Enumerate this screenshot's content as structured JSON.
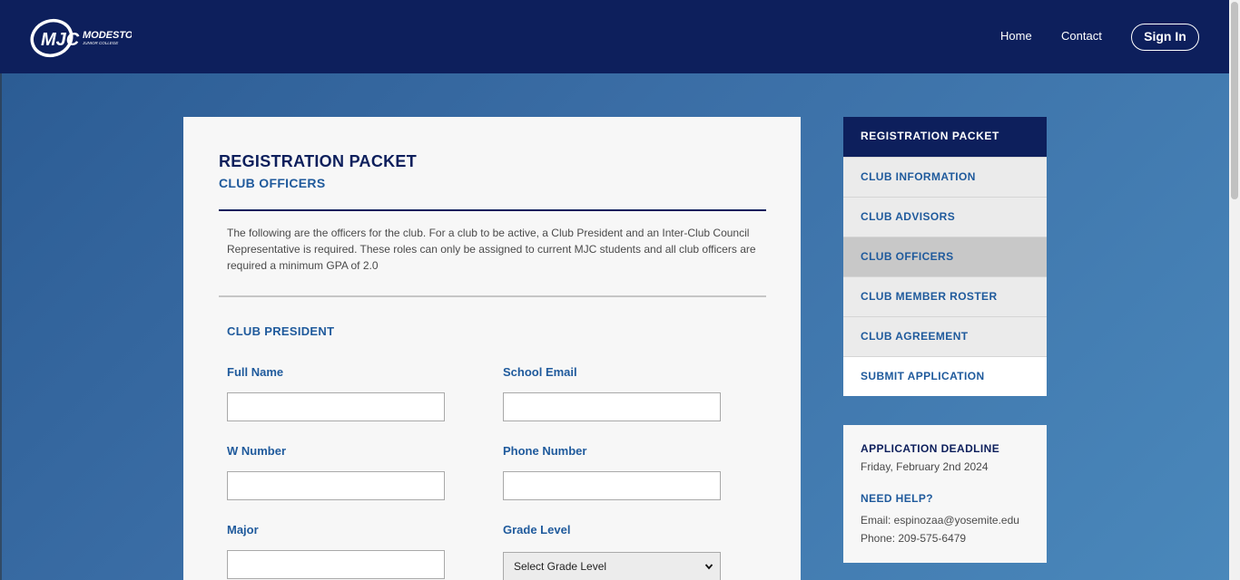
{
  "header": {
    "logo_text": "MJC MODESTO JUNIOR COLLEGE",
    "nav": [
      "Home",
      "Contact"
    ],
    "signin_label": "Sign In"
  },
  "main": {
    "title": "REGISTRATION PACKET",
    "subtitle": "CLUB OFFICERS",
    "intro": "The following are the officers for the club. For a club to be active, a Club President and an Inter-Club Council Representative is required. These roles can only be assigned to current MJC students and all club officers are required a minimum GPA of 2.0",
    "section": "CLUB PRESIDENT",
    "fields": {
      "full_name": "Full Name",
      "school_email": "School Email",
      "w_number": "W Number",
      "phone_number": "Phone Number",
      "major": "Major",
      "grade_level": "Grade Level",
      "grade_level_selected": "Select Grade Level"
    }
  },
  "sidebar": {
    "heading": "REGISTRATION PACKET",
    "items": [
      "CLUB INFORMATION",
      "CLUB ADVISORS",
      "CLUB OFFICERS",
      "CLUB MEMBER ROSTER",
      "CLUB AGREEMENT",
      "SUBMIT APPLICATION"
    ],
    "active_item": "CLUB OFFICERS"
  },
  "help": {
    "deadline_heading": "APPLICATION DEADLINE",
    "deadline": "Friday, February 2nd 2024",
    "help_heading": "NEED HELP?",
    "email": "Email: espinozaa@yosemite.edu",
    "phone": "Phone: 209-575-6479"
  },
  "colors": {
    "navy": "#0d1f5c",
    "accent_blue": "#1f5a9c",
    "bg_gradient_start": "#2a5a92",
    "bg_gradient_end": "#4a88bb"
  }
}
